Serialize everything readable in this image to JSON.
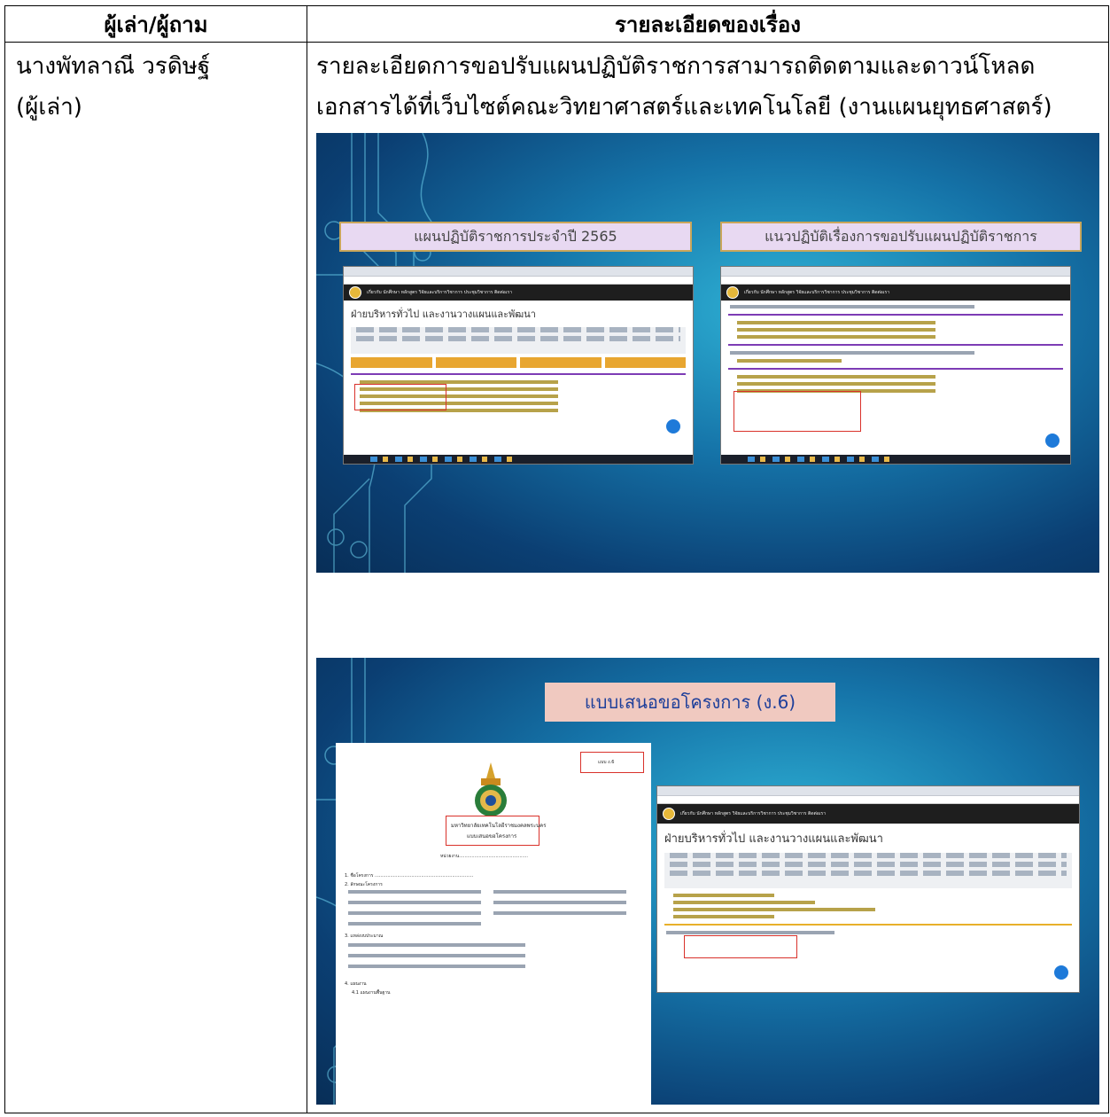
{
  "table": {
    "header_col1": "ผู้เล่า/ผู้ถาม",
    "header_col2": "รายละเอียดของเรื่อง",
    "narrator_name": "นางพัทลาณี วรดิษฐ์",
    "narrator_role": "(ผู้เล่า)",
    "detail_line1": "รายละเอียดการขอปรับแผนปฏิบัติราชการสามารถติดตามและดาวน์โหลด",
    "detail_line2": "เอกสารได้ที่เว็บไซต์คณะวิทยาศาสตร์และเทคโนโลยี (งานแผนยุทธศาสตร์)"
  },
  "slide1": {
    "left_heading": "แผนปฏิบัติราชการประจำปี 2565",
    "right_heading": "แนวปฏิบัติเรื่องการขอปรับแผนปฏิบัติราชการ",
    "page_title": "ฝ่ายบริหารทั่วไป และงานวางแผนและพัฒนา",
    "nav_text": "เกี่ยวกับ นักศึกษา หลักสูตร วิจัยและบริการวิชาการ ประชุมวิชาการ ติดต่อเรา"
  },
  "slide2": {
    "heading": "แบบเสนอขอโครงการ (ง.6)",
    "form_code": "แบบ ง.6",
    "form_university": "มหาวิทยาลัยเทคโนโลยีราชมงคลพระนคร",
    "form_title": "แบบเสนอขอโครงการ",
    "form_unit": "หน่วยงาน.................................................",
    "form_items": [
      "1. ชื่อโครงการ ......................................................................",
      "2. ลักษณะโครงการ",
      "3. แหล่งงบประมาณ",
      "4. แผนงาน",
      "4.1 แผนงานพื้นฐาน"
    ],
    "page_title": "ฝ่ายบริหารทั่วไป และงานวางแผนและพัฒนา",
    "nav_text": "เกี่ยวกับ นักศึกษา หลักสูตร วิจัยและบริการวิชาการ ประชุมวิชาการ ติดต่อเรา"
  },
  "colors": {
    "slide_bg": "#1573a8",
    "red_box": "#d9322b",
    "heading_blue": "#1e3f9a"
  }
}
